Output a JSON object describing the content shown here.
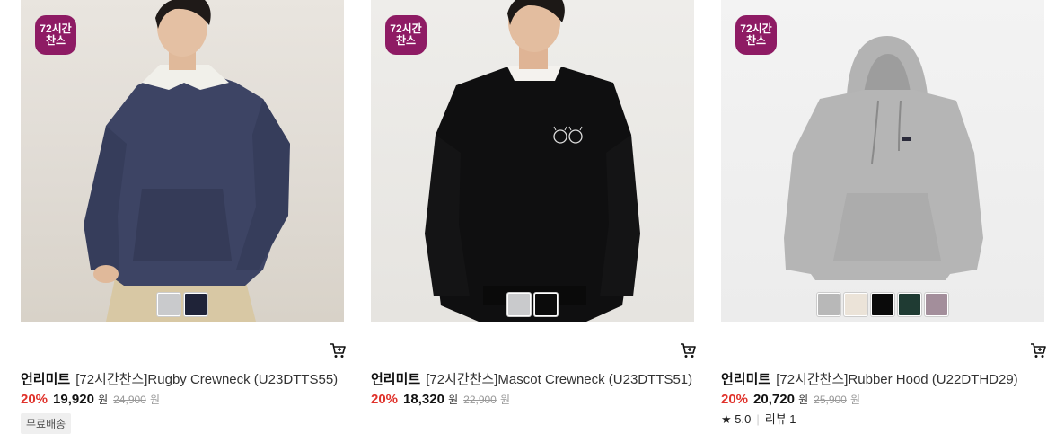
{
  "products": [
    {
      "badge": [
        "72시간",
        "찬스"
      ],
      "brand": "언리미트",
      "title": "[72시간찬스]Rugby Crewneck (U23DTTS55)",
      "discount": "20%",
      "sale_price": "19,920",
      "currency": "원",
      "original_price": "24,900",
      "tag": "무료배송",
      "swatches": [
        "#c9cacc",
        "#1f2338"
      ]
    },
    {
      "badge": [
        "72시간",
        "찬스"
      ],
      "brand": "언리미트",
      "title": "[72시간찬스]Mascot Crewneck (U23DTTS51)",
      "discount": "20%",
      "sale_price": "18,320",
      "currency": "원",
      "original_price": "22,900",
      "swatches": [
        "#c9cacc",
        "#0b0b0b"
      ]
    },
    {
      "badge": [
        "72시간",
        "찬스"
      ],
      "brand": "언리미트",
      "title": "[72시간찬스]Rubber Hood (U22DTHD29)",
      "discount": "20%",
      "sale_price": "20,720",
      "currency": "원",
      "original_price": "25,900",
      "rating": "5.0",
      "review_label": "리뷰 1",
      "swatches": [
        "#b8b8b8",
        "#ebe3d8",
        "#0a0a0a",
        "#1f3b33",
        "#a38e9b"
      ]
    }
  ],
  "icons": {
    "cart": "cart-icon",
    "star": "star-icon"
  },
  "colors": {
    "badge": "#8e1b64",
    "discount": "#e0322b"
  }
}
